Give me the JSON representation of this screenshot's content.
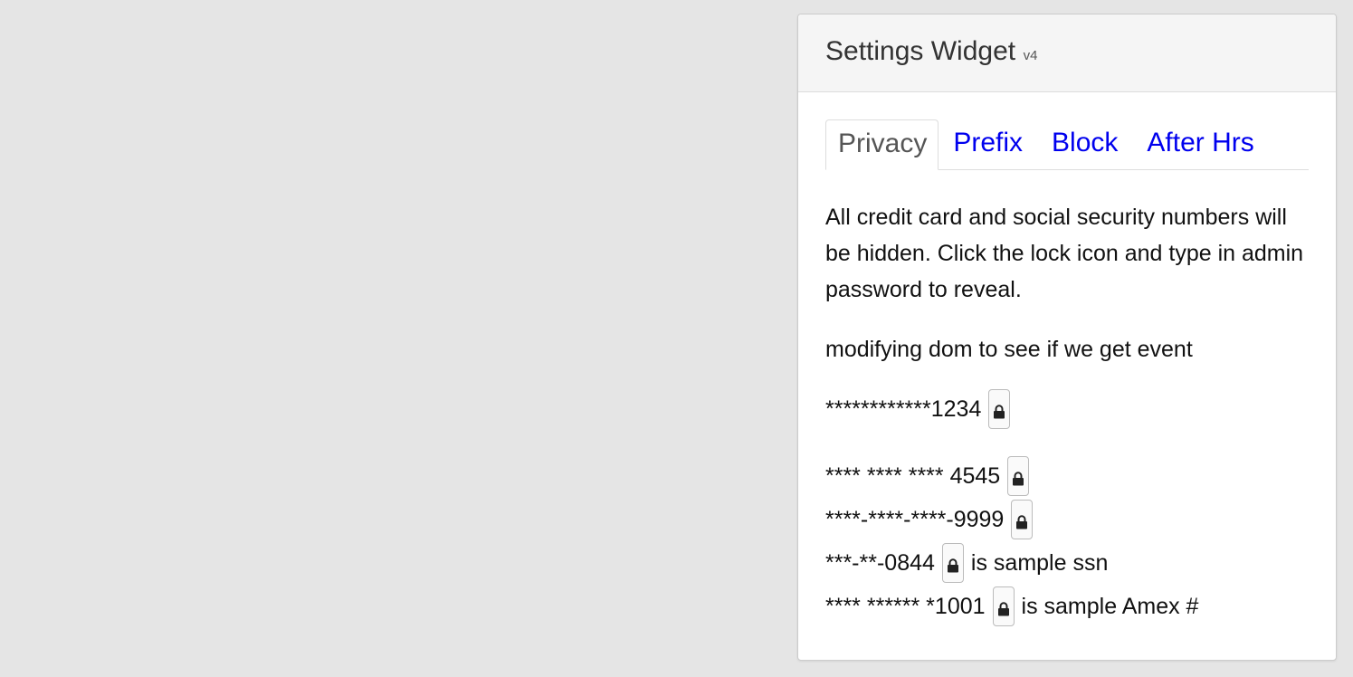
{
  "widget": {
    "title": "Settings Widget",
    "version": "v4"
  },
  "tabs": [
    {
      "label": "Privacy",
      "active": true
    },
    {
      "label": "Prefix",
      "active": false
    },
    {
      "label": "Block",
      "active": false
    },
    {
      "label": "After Hrs",
      "active": false
    }
  ],
  "privacy": {
    "description": "All credit card and social security numbers will be hidden. Click the lock icon and type in admin password to reveal.",
    "note": "modifying dom to see if we get event",
    "masked_items": [
      {
        "value": "************1234",
        "suffix": ""
      },
      {
        "value": "**** **** **** 4545",
        "suffix": ""
      },
      {
        "value": "****-****-****-9999",
        "suffix": ""
      },
      {
        "value": "***-**-0844",
        "suffix": "is sample ssn"
      },
      {
        "value": "**** ****** *1001",
        "suffix": "is sample Amex #"
      }
    ],
    "lock_icon": "lock-icon"
  },
  "colors": {
    "link": "#0000ee",
    "active_tab_text": "#555555",
    "page_background": "#e5e5e5",
    "header_background": "#f5f5f5"
  }
}
